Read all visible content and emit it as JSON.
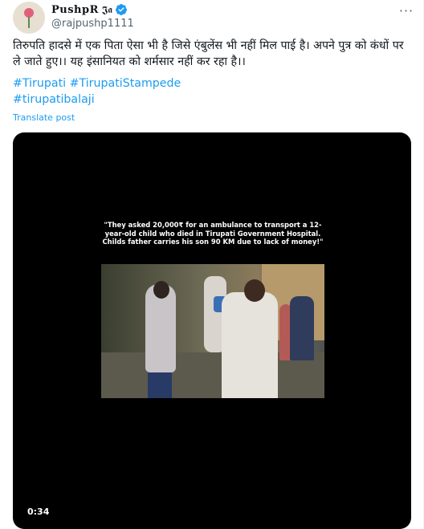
{
  "user": {
    "display_name": "PushpR",
    "name_glyph": "𝕵𝖆",
    "handle": "@rajpushp1111",
    "avatar_icon": "flower-avatar",
    "verified_color": "#1d9bf0"
  },
  "more_label": "···",
  "tweet": {
    "text": "तिरुपति हादसे में एक पिता ऐसा भी है जिसे एंबुलेंस भी नहीं मिल पाई है। अपने पुत्र को कंधों पर ले जाते हुए।। यह इंसानियत को शर्मसार नहीं कर रहा है।।",
    "hashtags": [
      "#Tirupati",
      "#TirupatiStampede",
      "#tirupatibalaji"
    ],
    "translate_label": "Translate post"
  },
  "media": {
    "caption": "\"They asked 20,000₹ for an ambulance to transport a 12-year-old child who died in Tirupati Government Hospital. Childs father carries his son 90 KM due to lack of money!\"",
    "duration": "0:34"
  },
  "colors": {
    "link": "#1d9bf0",
    "text": "#0f1419",
    "muted": "#536471"
  }
}
